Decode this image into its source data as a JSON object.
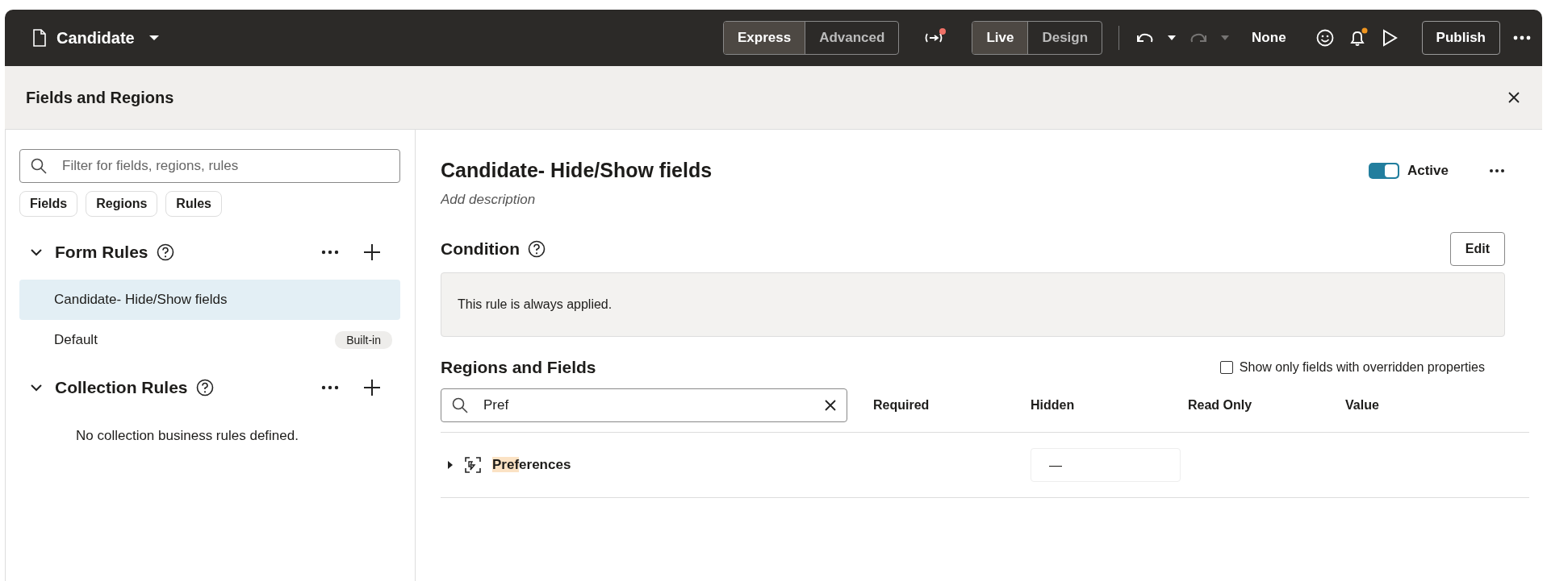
{
  "topbar": {
    "page_title": "Candidate",
    "modes": [
      {
        "label": "Express",
        "selected": true
      },
      {
        "label": "Advanced",
        "selected": false
      }
    ],
    "views": [
      {
        "label": "Live",
        "selected": true
      },
      {
        "label": "Design",
        "selected": false
      }
    ],
    "undo_disabled": false,
    "redo_disabled": true,
    "sandbox": "None",
    "publish": "Publish"
  },
  "panel": {
    "title": "Fields and Regions"
  },
  "sidebar": {
    "search": {
      "placeholder": "Filter for fields, regions, rules"
    },
    "chips": [
      "Fields",
      "Regions",
      "Rules"
    ],
    "sections": [
      {
        "title": "Form Rules",
        "expanded": true,
        "items": [
          {
            "label": "Candidate- Hide/Show fields",
            "selected": true
          },
          {
            "label": "Default",
            "badge": "Built-in",
            "selected": false
          }
        ]
      },
      {
        "title": "Collection Rules",
        "expanded": true,
        "empty": "No collection business rules defined."
      }
    ]
  },
  "rule": {
    "title": "Candidate- Hide/Show fields",
    "active": true,
    "active_label": "Active",
    "description_placeholder": "Add description",
    "condition": {
      "title": "Condition",
      "edit": "Edit",
      "text": "This rule is always applied."
    },
    "regions": {
      "title": "Regions and Fields",
      "override_filter": {
        "label": "Show only fields with overridden properties",
        "checked": false
      },
      "search": {
        "value": "Pref"
      },
      "columns": [
        "Required",
        "Hidden",
        "Read Only",
        "Value"
      ],
      "rows": [
        {
          "name_match": "Pref",
          "name_rest": "erences",
          "expanded": false,
          "hidden_value": "—"
        }
      ]
    }
  }
}
